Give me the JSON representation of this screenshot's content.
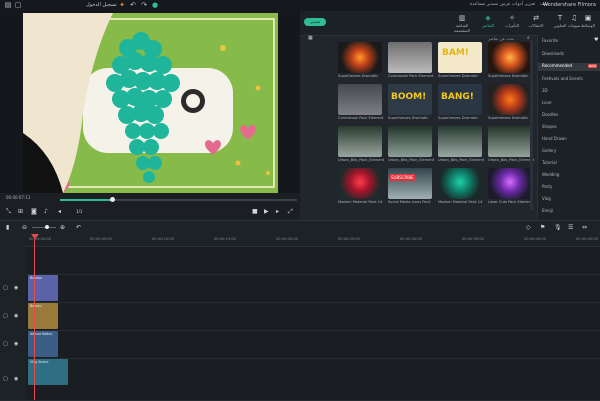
{
  "titlebar": {
    "app_title": "Wondershare Filmora",
    "project_name": "تسجيل الدخول",
    "menus": [
      "ملف",
      "تحرير",
      "أدوات",
      "عرض",
      "تصدير",
      "مساعدة"
    ]
  },
  "preview": {
    "timecode": "00:00:07:11",
    "zoom": "1/1"
  },
  "library": {
    "export_button": "تصدير",
    "search_placeholder": "بحث عن عناصر",
    "tabs": [
      "الوسائط",
      "صوتيات",
      "العناوين",
      "الانتقالات",
      "التأثيرات",
      "العناصر",
      "الشاشة المنقسمة"
    ],
    "sidebar": [
      "Favorite",
      "Downloads",
      "Recommended",
      "Festivals and Events",
      "3D",
      "Love",
      "Doodles",
      "Shapes",
      "Hand Drawn",
      "Gallery",
      "Tutorial",
      "Wedding",
      "Party",
      "Vlog",
      "Emoji"
    ],
    "recommended_badge": "NEW",
    "items": [
      {
        "label": "Superheroes Dramatic",
        "text": ""
      },
      {
        "label": "Comicbook Pack Element",
        "text": ""
      },
      {
        "label": "Superheroes Dramatic",
        "text": "BAM!"
      },
      {
        "label": "Superheroes Dramatic",
        "text": ""
      },
      {
        "label": "Comicbook Pack Element",
        "text": ""
      },
      {
        "label": "Superheroes Dramatic",
        "text": "BOOM!"
      },
      {
        "label": "Superheroes Dramatic",
        "text": "BANG!"
      },
      {
        "label": "Superheroes Dramatic",
        "text": ""
      },
      {
        "label": "Urban_Bits_Pack_Element",
        "text": ""
      },
      {
        "label": "Urban_Bits_Pack_Element",
        "text": ""
      },
      {
        "label": "Urban_Bits_Pack_Element",
        "text": ""
      },
      {
        "label": "Urban_Bits_Pack_Element",
        "text": ""
      },
      {
        "label": "Modern Material Pack 14",
        "text": ""
      },
      {
        "label": "Social Media Icons Pack",
        "text": "SUBSCRIBE"
      },
      {
        "label": "Modern Material Pack 14",
        "text": ""
      },
      {
        "label": "Laser Cuts Pack Element",
        "text": ""
      }
    ]
  },
  "timeline": {
    "ruler": [
      "00:00:00:00",
      "00:00:05:00",
      "00:00:10:00",
      "00:00:15:00",
      "00:00:20:00",
      "00:00:25:00",
      "00:00:30:00",
      "00:00:35:00",
      "00:00:40:00",
      "00:00:45:00"
    ],
    "clips": [
      {
        "name": "Balloon",
        "color": "#5b63a8"
      },
      {
        "name": "Ballons",
        "color": "#9a7a3a"
      },
      {
        "name": "Nature Ballon",
        "color": "#3b5d86"
      },
      {
        "name": "Vlog Scene",
        "color": "#2f6f84"
      }
    ]
  },
  "colors": {
    "accent": "#2ebd92",
    "playhead": "#e54b4b"
  }
}
